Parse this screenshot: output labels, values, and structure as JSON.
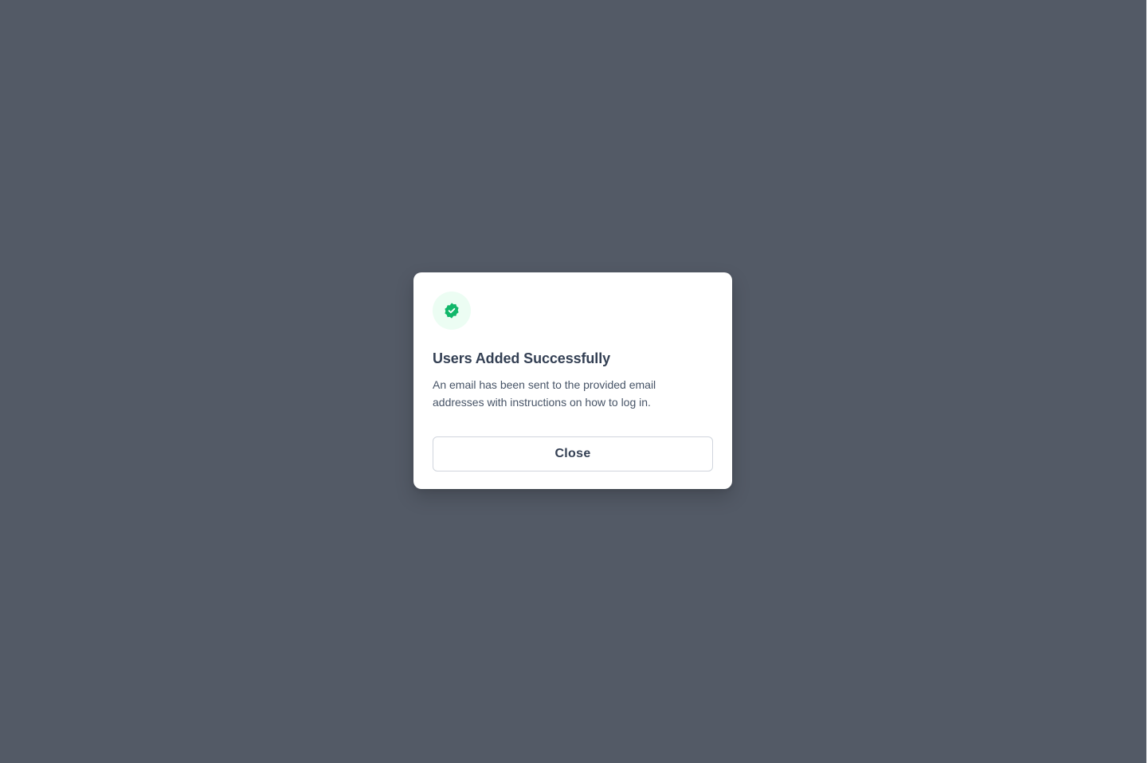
{
  "colors": {
    "overlay": "#535a66",
    "modal_background": "#ffffff",
    "success_icon": "#12b76a",
    "success_icon_background": "#ecfdf3",
    "title_text": "#344054",
    "body_text": "#475467",
    "button_border": "#d0d5dd"
  },
  "modal": {
    "icon": "verified-badge-icon",
    "title": "Users Added Successfully",
    "description": "An email has been sent to the provided email addresses with instructions on how to log in.",
    "close_label": "Close"
  }
}
